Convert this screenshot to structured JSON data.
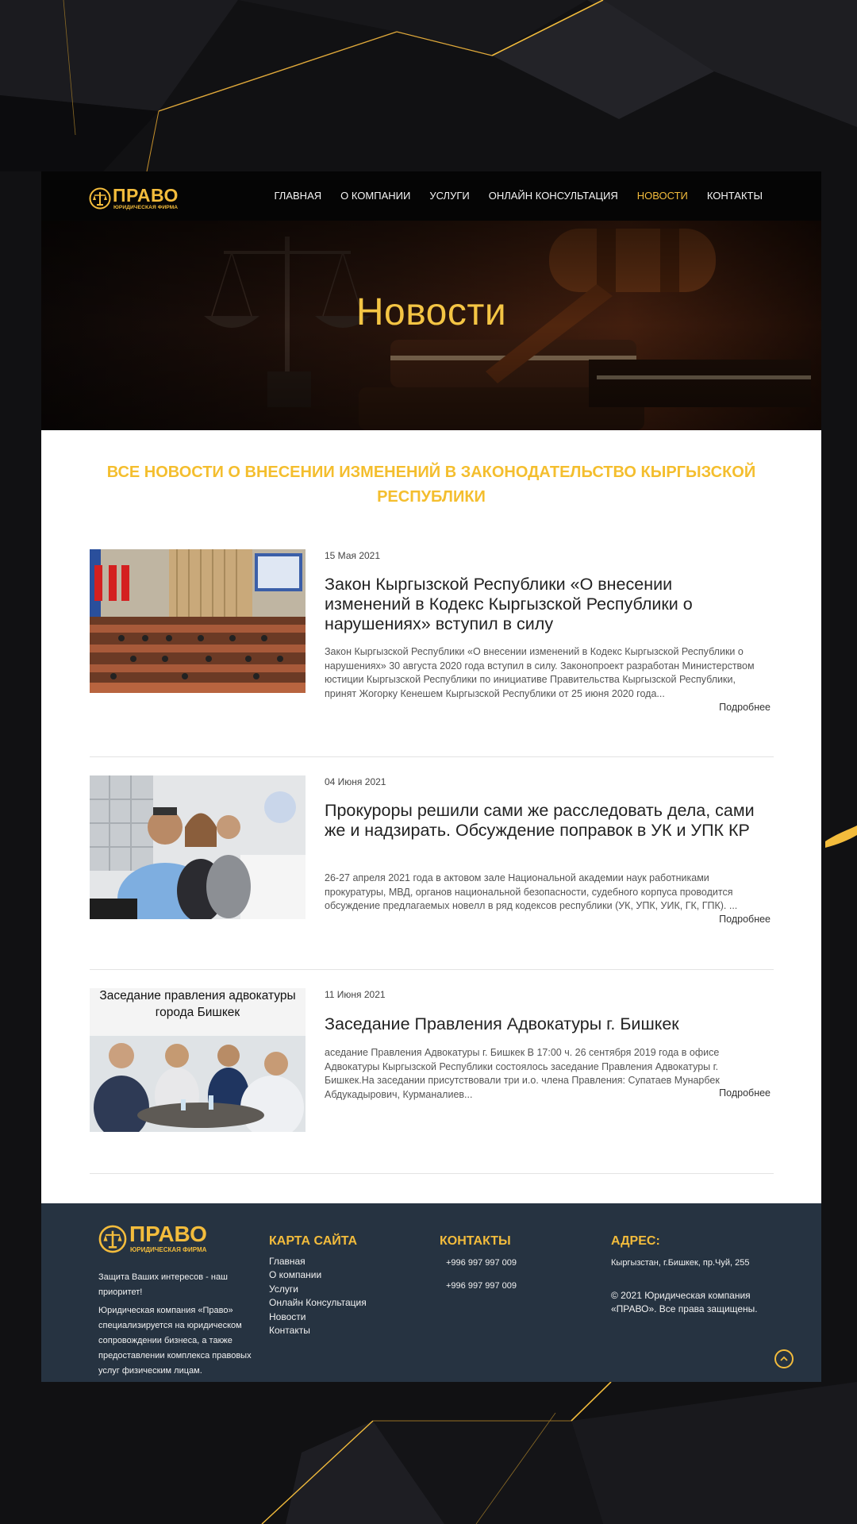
{
  "colors": {
    "accent": "#f3bc3c",
    "footer_bg": "#263341",
    "page_bg": "#101012"
  },
  "header": {
    "logo": {
      "title": "ПРАВО",
      "subtitle": "ЮРИДИЧЕСКАЯ ФИРМА"
    },
    "nav": [
      {
        "label": "ГЛАВНАЯ",
        "active": false
      },
      {
        "label": "О КОМПАНИИ",
        "active": false
      },
      {
        "label": "УСЛУГИ",
        "active": false
      },
      {
        "label": "ОНЛАЙН КОНСУЛЬТАЦИЯ",
        "active": false
      },
      {
        "label": "НОВОСТИ",
        "active": true
      },
      {
        "label": "КОНТАКТЫ",
        "active": false
      }
    ]
  },
  "hero": {
    "title": "Новости"
  },
  "section": {
    "title": "ВСЕ НОВОСТИ О ВНЕСЕНИИ ИЗМЕНЕНИЙ В ЗАКОНОДАТЕЛЬСТВО КЫРГЫЗСКОЙ РЕСПУБЛИКИ"
  },
  "news": [
    {
      "date": "15 Мая 2021",
      "title": "Закон Кыргызской Республики «О внесении изменений в Кодекс Кыргызской Республики о нарушениях» вступил в силу",
      "text": "Закон Кыргызской Республики «О внесении изменений в Кодекс Кыргызской Республики о нарушениях» 30 августа 2020 года вступил в силу. Законопроект разработан Министерством юстиции Кыргызской Республики по инициативе Правительства Кыргызской Республики, принят Жогорку Кенешем Кыргызской Республики от 25 июня 2020 года...",
      "more": "Подробнее"
    },
    {
      "date": "04 Июня 2021",
      "title": "Прокуроры решили сами же расследовать дела, сами же и надзирать. Обсуждение поправок в УК и УПК КР",
      "text": "26-27 апреля 2021 года в актовом зале Национальной академии наук работниками прокуратуры, МВД, органов национальной безопасности, судебного корпуса проводится обсуждение предлагаемых новелл в ряд кодексов республики (УК, УПК, УИК, ГК, ГПК). ...",
      "more": "Подробнее"
    },
    {
      "date": "11 Июня 2021",
      "title": "Заседание Правления Адвокатуры г. Бишкек",
      "text": "аседание Правления Адвокатуры г. Бишкек В 17:00 ч. 26 сентября 2019 года в офисе Адвокатуры Кыргызской Республики состоялось заседание Правления Адвокатуры г. Бишкек.На заседании присутствовали три и.о. члена Правления: Супатаев Мунарбек Абдукадырович, Курманалиев...",
      "more": "Подробнее",
      "image_caption": "Заседание правления адвокатуры города Бишкек"
    }
  ],
  "footer": {
    "logo": {
      "title": "ПРАВО",
      "subtitle": "ЮРИДИЧЕСКАЯ ФИРМА"
    },
    "tagline": "Защита Ваших интересов - наш приоритет!",
    "about": "Юридическая компания «Право» специализируется на юридическом сопровождении бизнеса, а также предоставлении комплекса правовых услуг физическим лицам.",
    "sitemap_title": "КАРТА САЙТА",
    "sitemap": [
      "Главная",
      "О компании",
      "Услуги",
      "Онлайн Консультация",
      "Новости",
      "Контакты"
    ],
    "contacts_title": "КОНТАКТЫ",
    "phones": [
      "+996 997 997 009",
      "+996 997 997 009"
    ],
    "address_title": "АДРЕС:",
    "address": "Кыргызстан, г.Бишкек, пр.Чуй, 255",
    "copyright": "© 2021 Юридическая компания «ПРАВО». Все права защищены."
  },
  "icons": {
    "logo_mark": "scales-of-justice-icon",
    "scroll_top": "chevron-up-icon"
  }
}
